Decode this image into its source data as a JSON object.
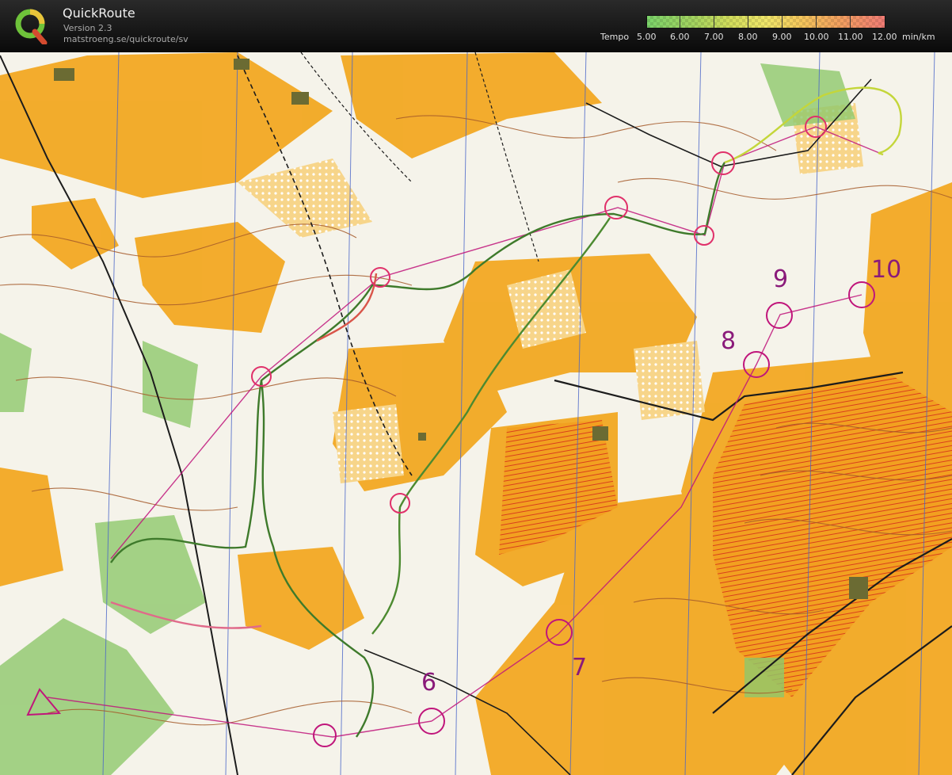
{
  "header": {
    "title": "QuickRoute",
    "version": "Version 2.3",
    "url": "matstroeng.se/quickroute/sv",
    "logo_letter": "Q"
  },
  "legend": {
    "label": "Tempo",
    "ticks": [
      "5.00",
      "6.00",
      "7.00",
      "8.00",
      "9.00",
      "10.00",
      "11.00",
      "12.00"
    ],
    "unit": "min/km",
    "colors": [
      "#7bd36a",
      "#a4d35f",
      "#d2dd5c",
      "#efe66a",
      "#f4c65c",
      "#f2a25e",
      "#f07b74"
    ]
  },
  "map": {
    "control_numbers": [
      "6",
      "7",
      "8",
      "9",
      "10"
    ],
    "colors": {
      "open_land": "#f2a61c",
      "rough_open": "#f7c957",
      "forest": "#f8f7f1",
      "green": "#8fc86c",
      "contour": "#a55a2a",
      "water_blue": "#4a66c9",
      "course": "#c0157b",
      "route_line": "#3e7a2b"
    }
  }
}
